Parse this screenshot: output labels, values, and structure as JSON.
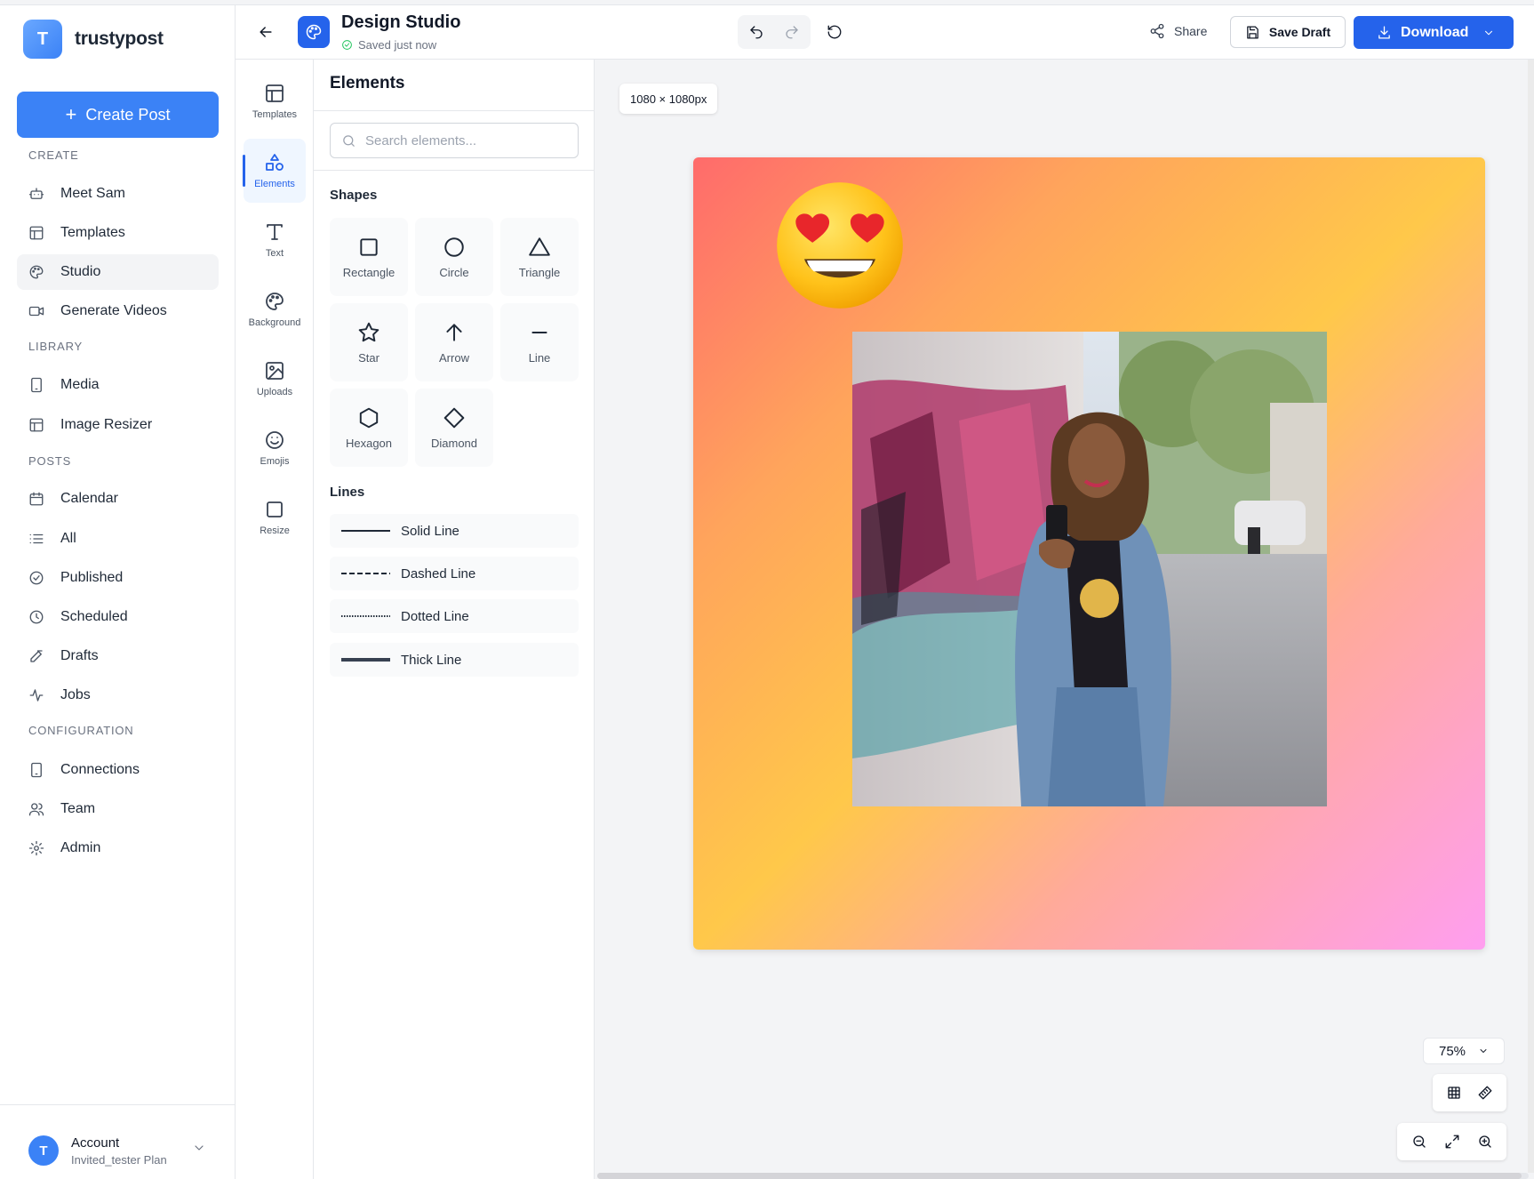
{
  "brand": {
    "logo_letter": "T",
    "name": "trustypost"
  },
  "sidebar": {
    "create_button": "Create Post",
    "sections": {
      "create": "CREATE",
      "library": "LIBRARY",
      "posts": "POSTS",
      "configuration": "CONFIGURATION"
    },
    "items": {
      "meet_sam": "Meet Sam",
      "templates": "Templates",
      "studio": "Studio",
      "generate_videos": "Generate Videos",
      "media": "Media",
      "image_resizer": "Image Resizer",
      "calendar": "Calendar",
      "all": "All",
      "published": "Published",
      "scheduled": "Scheduled",
      "drafts": "Drafts",
      "jobs": "Jobs",
      "connections": "Connections",
      "team": "Team",
      "admin": "Admin"
    },
    "active_item": "Studio",
    "account": {
      "avatar_letter": "T",
      "name": "Account",
      "plan": "Invited_tester Plan"
    }
  },
  "header": {
    "title": "Design Studio",
    "status": "Saved just now",
    "share": "Share",
    "save_draft": "Save Draft",
    "download": "Download"
  },
  "rail": {
    "templates": "Templates",
    "elements": "Elements",
    "text": "Text",
    "background": "Background",
    "uploads": "Uploads",
    "emojis": "Emojis",
    "resize": "Resize",
    "active": "Elements"
  },
  "panel": {
    "title": "Elements",
    "search_placeholder": "Search elements...",
    "shapes_heading": "Shapes",
    "shapes": {
      "rectangle": "Rectangle",
      "circle": "Circle",
      "triangle": "Triangle",
      "star": "Star",
      "arrow": "Arrow",
      "line": "Line",
      "hexagon": "Hexagon",
      "diamond": "Diamond"
    },
    "lines_heading": "Lines",
    "lines": {
      "solid": "Solid Line",
      "dashed": "Dashed Line",
      "dotted": "Dotted Line",
      "thick": "Thick Line"
    }
  },
  "canvas": {
    "dimensions": "1080 × 1080px",
    "zoom": "75%",
    "background_gradient": [
      "#ff6b6b",
      "#ffc84a",
      "#ff9ef0"
    ],
    "sticker": "heart-eyes-emoji",
    "image": "woman-with-phone-street-photo"
  },
  "colors": {
    "primary": "#2563eb",
    "accent": "#3b82f6",
    "saved_check": "#22c55e"
  }
}
